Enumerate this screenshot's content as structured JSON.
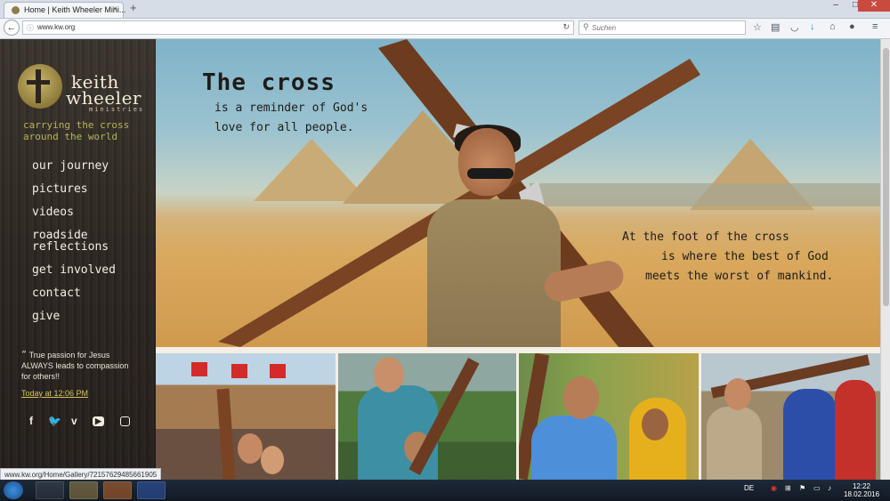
{
  "browser": {
    "tab_title": "Home | Keith Wheeler Mini...",
    "url": "www.kw.org",
    "search_placeholder": "Suchen",
    "status_url": "www.kw.org/Home/Gallery/72157629485661905"
  },
  "sidebar": {
    "brand_line1": "keith",
    "brand_line2": "wheeler",
    "brand_line3": "ministries",
    "tagline": "carrying the cross around the world",
    "nav": [
      "our journey",
      "pictures",
      "videos",
      "roadside reflections",
      "get involved",
      "contact",
      "give"
    ],
    "quote": "True passion for Jesus ALWAYS leads to compassion for others!!",
    "timestamp": "Today at 12:06 PM",
    "social_icons": [
      "facebook-icon",
      "twitter-icon",
      "vimeo-icon",
      "youtube-icon",
      "instagram-icon"
    ]
  },
  "hero": {
    "heading": "The cross",
    "line1": "is a reminder of God's",
    "line2": "love for all people.",
    "right1": "At the foot of the cross",
    "right2": "is where the best of God",
    "right3": "meets the worst of mankind."
  },
  "taskbar": {
    "lang": "DE",
    "time": "12:22",
    "date": "18.02.2016"
  },
  "colors": {
    "sidebar_bg": "#2b2520",
    "tagline": "#b3b55a",
    "link_gold": "#d6c35c"
  }
}
